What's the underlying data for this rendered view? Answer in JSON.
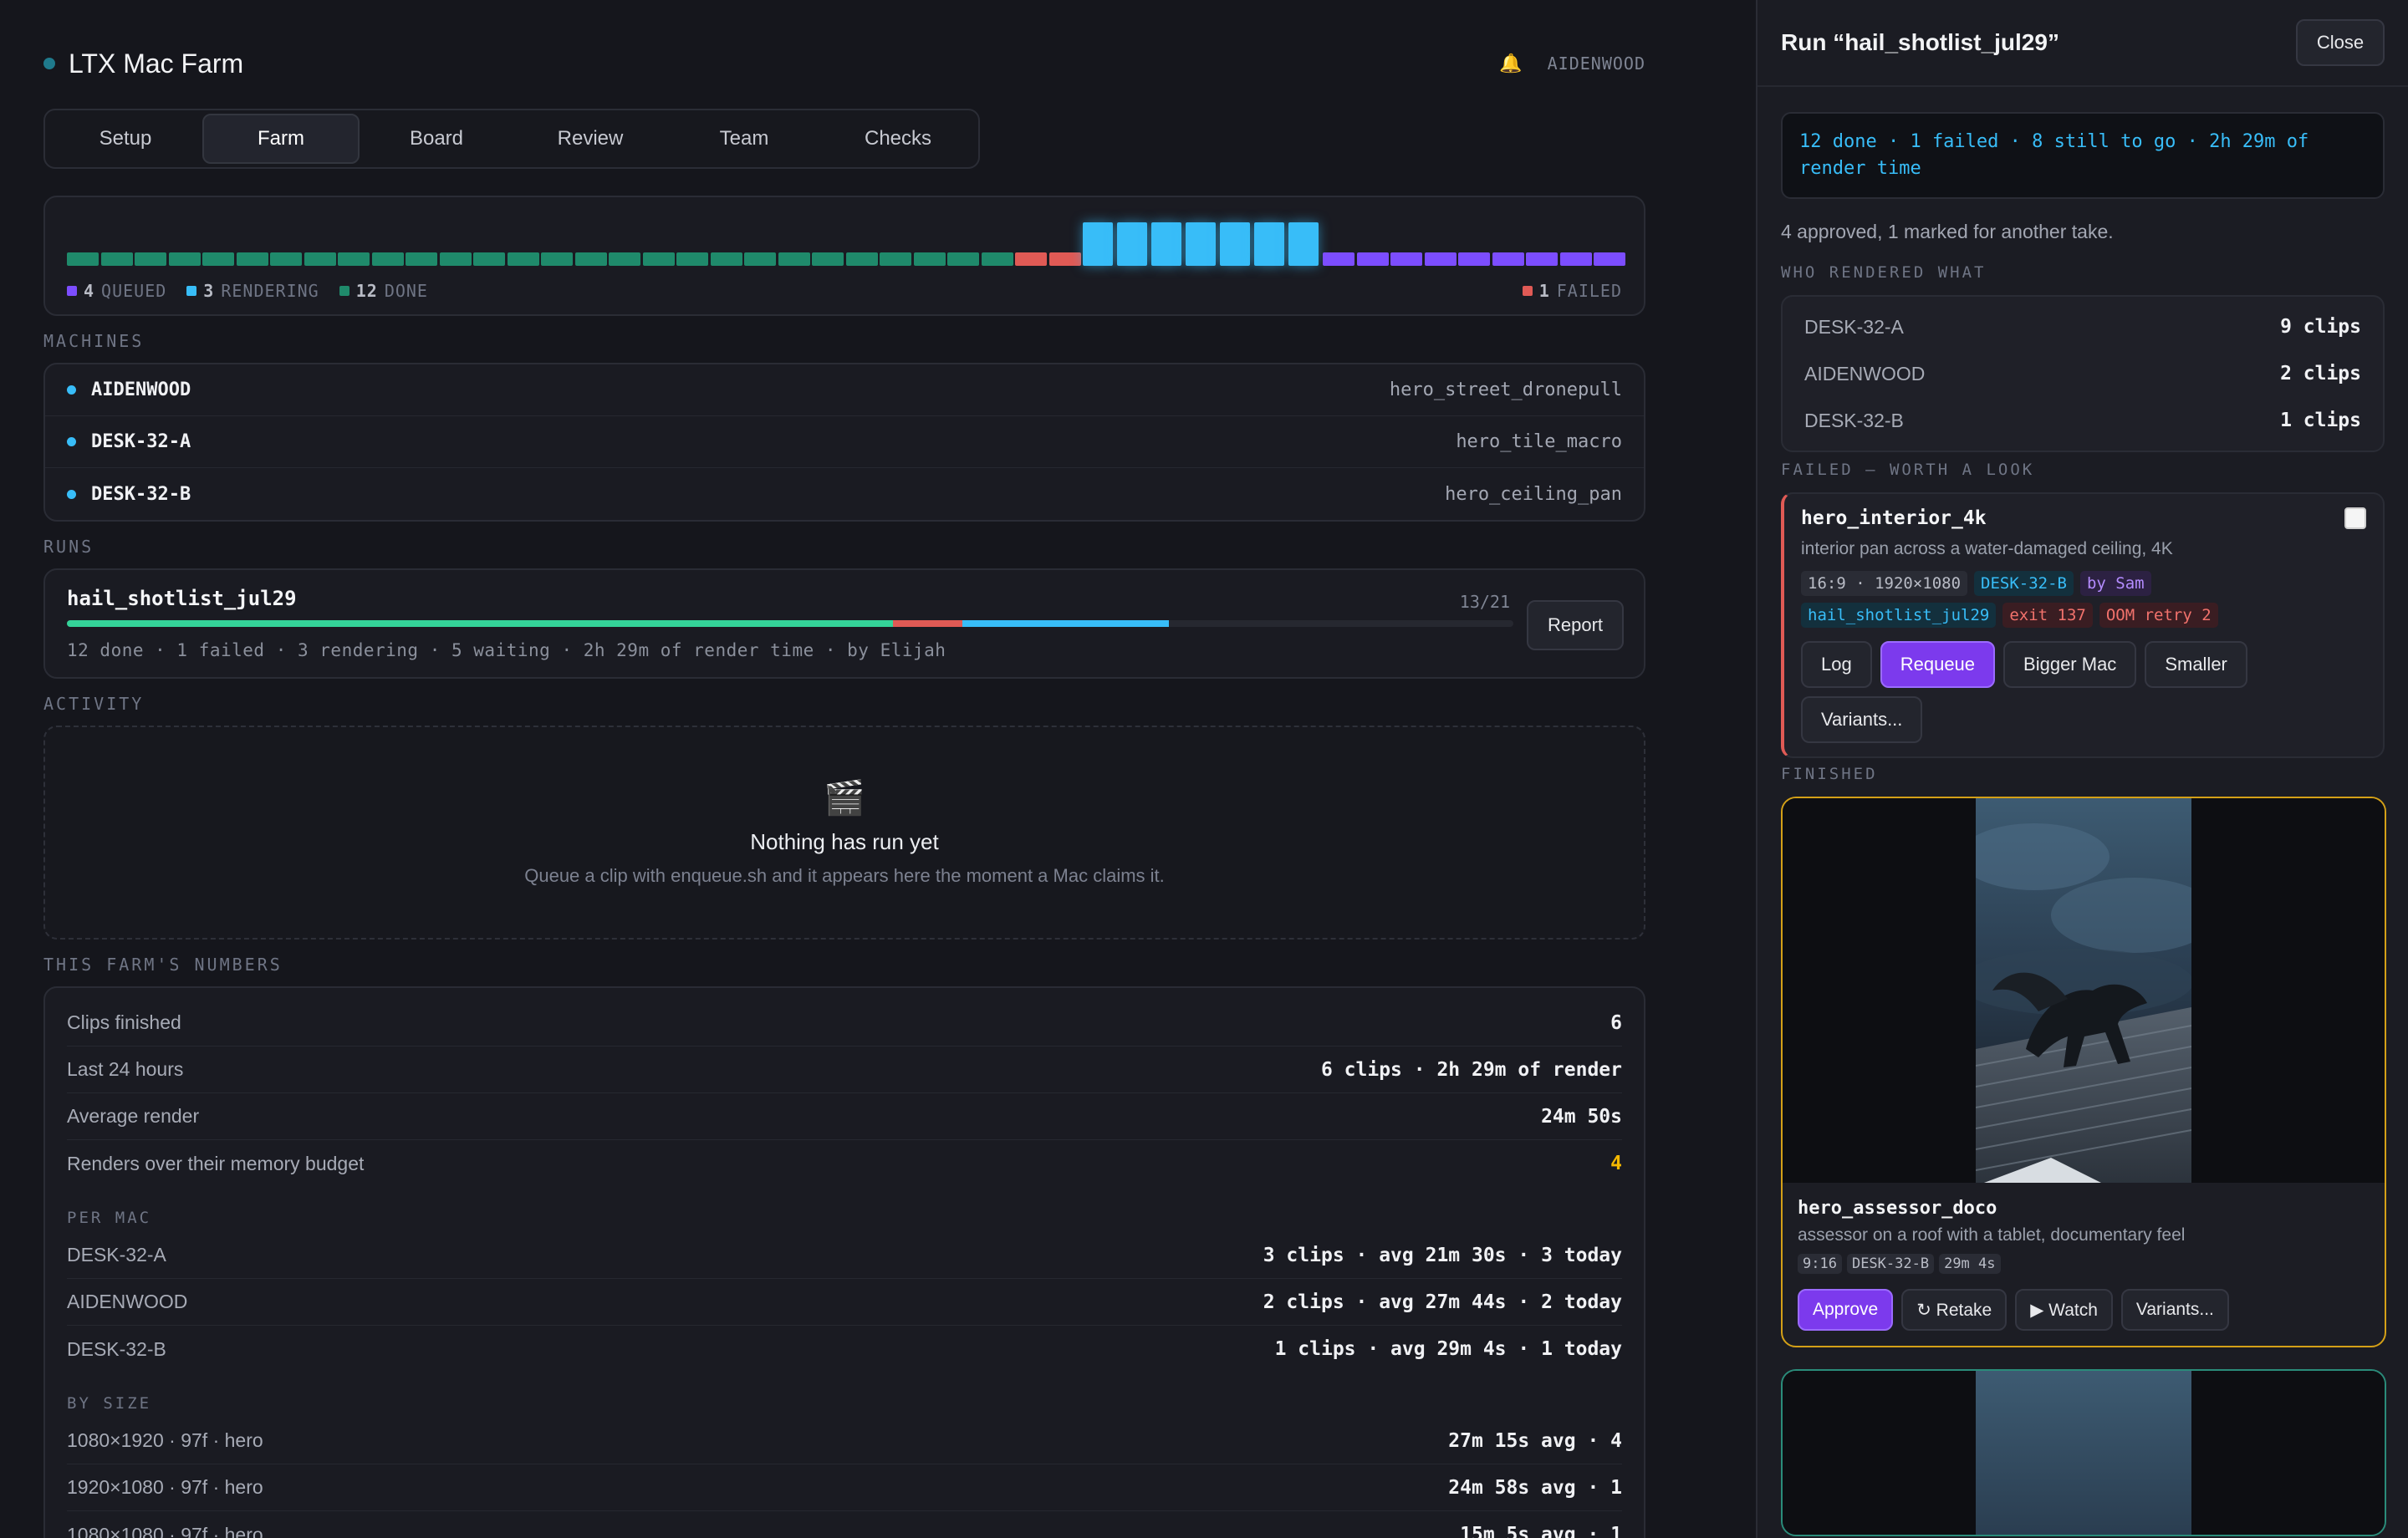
{
  "header": {
    "title": "LTX Mac Farm",
    "user": "AIDENWOOD"
  },
  "tabs": [
    "Setup",
    "Farm",
    "Board",
    "Review",
    "Team",
    "Checks"
  ],
  "timeline": {
    "legend": {
      "queued_n": "4",
      "queued_l": "QUEUED",
      "rendering_n": "3",
      "rendering_l": "RENDERING",
      "done_n": "12",
      "done_l": "DONE",
      "failed_n": "1",
      "failed_l": "FAILED"
    }
  },
  "sections": {
    "machines": "MACHINES",
    "runs": "RUNS",
    "activity": "ACTIVITY",
    "numbers": "THIS FARM'S NUMBERS"
  },
  "machines": [
    {
      "name": "AIDENWOOD",
      "job": "hero_street_dronepull"
    },
    {
      "name": "DESK-32-A",
      "job": "hero_tile_macro"
    },
    {
      "name": "DESK-32-B",
      "job": "hero_ceiling_pan"
    }
  ],
  "run": {
    "name": "hail_shotlist_jul29",
    "count": "13/21",
    "meta": "12 done · 1 failed · 3 rendering · 5 waiting · 2h 29m of render time · by Elijah",
    "report_label": "Report",
    "progress": {
      "done": 0.571,
      "failed": 0.048,
      "rendering": 0.143
    }
  },
  "activity": {
    "title": "Nothing has run yet",
    "subtitle": "Queue a clip with enqueue.sh and it appears here the moment a Mac claims it."
  },
  "numbers": {
    "rows": [
      {
        "k": "Clips finished",
        "v": "6"
      },
      {
        "k": "Last 24 hours",
        "v": "6 clips · 2h 29m of render"
      },
      {
        "k": "Average render",
        "v": "24m 50s"
      },
      {
        "k": "Renders over their memory budget",
        "v": "4"
      }
    ],
    "per_mac_label": "PER MAC",
    "per_mac": [
      {
        "k": "DESK-32-A",
        "v": "3 clips · avg 21m 30s · 3 today"
      },
      {
        "k": "AIDENWOOD",
        "v": "2 clips · avg 27m 44s · 2 today"
      },
      {
        "k": "DESK-32-B",
        "v": "1 clips · avg 29m 4s · 1 today"
      }
    ],
    "by_size_label": "BY SIZE",
    "by_size": [
      {
        "k": "1080×1920 · 97f · hero",
        "v": "27m 15s avg · 4"
      },
      {
        "k": "1920×1080 · 97f · hero",
        "v": "24m 58s avg · 1"
      },
      {
        "k": "1080×1080 · 97f · hero",
        "v": "15m 5s avg · 1"
      }
    ]
  },
  "side": {
    "title": "Run “hail_shotlist_jul29”",
    "close_label": "Close",
    "summary": "12 done · 1 failed · 8 still to go · 2h 29m of render time",
    "approved": "4 approved, 1 marked for another take.",
    "who_label": "WHO RENDERED WHAT",
    "who": [
      {
        "k": "DESK-32-A",
        "v": "9 clips"
      },
      {
        "k": "AIDENWOOD",
        "v": "2 clips"
      },
      {
        "k": "DESK-32-B",
        "v": "1 clips"
      }
    ],
    "failed_label": "FAILED — WORTH A LOOK",
    "failed": {
      "name": "hero_interior_4k",
      "desc": "interior pan across a water-damaged ceiling, 4K",
      "chips": [
        "16:9 · 1920×1080",
        "DESK-32-B",
        "by Sam",
        "hail_shotlist_jul29",
        "exit 137",
        "OOM retry 2"
      ],
      "buttons": [
        "Log",
        "Requeue",
        "Bigger Mac",
        "Smaller",
        "Variants..."
      ]
    },
    "finished_label": "FINISHED",
    "finished": {
      "name": "hero_assessor_doco",
      "desc": "assessor on a roof with a tablet, documentary feel",
      "chips": [
        "9:16",
        "DESK-32-B",
        "29m 4s"
      ],
      "buttons": [
        "Approve",
        "↻ Retake",
        "▶ Watch",
        "Variants..."
      ]
    }
  },
  "colors": {
    "queued": "#7c4dff",
    "rendering": "#38bdf8",
    "done": "#1f8a6b",
    "failed": "#e05a55",
    "amber": "#f5b800"
  }
}
